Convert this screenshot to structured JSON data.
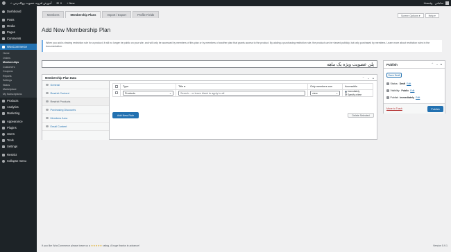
{
  "adminbar": {
    "site_name": "آموزش افزونه عضویت ووکامرس",
    "comments_count": "0",
    "new_label": "+ New",
    "howdy": "Howdy,",
    "username": "سامانی"
  },
  "sidebar": {
    "items": [
      {
        "label": "Dashboard",
        "icon": "dashboard-icon"
      },
      {
        "label": "Posts",
        "icon": "pin-icon"
      },
      {
        "label": "Media",
        "icon": "media-icon"
      },
      {
        "label": "Pages",
        "icon": "page-icon"
      },
      {
        "label": "Comments",
        "icon": "comment-icon"
      },
      {
        "label": "WooCommerce",
        "icon": "woo-icon",
        "active": true
      },
      {
        "label": "Products",
        "icon": "box-icon"
      },
      {
        "label": "Analytics",
        "icon": "chart-icon"
      },
      {
        "label": "Marketing",
        "icon": "megaphone-icon"
      },
      {
        "label": "Appearance",
        "icon": "brush-icon"
      },
      {
        "label": "Plugins",
        "icon": "plug-icon"
      },
      {
        "label": "Users",
        "icon": "user-icon"
      },
      {
        "label": "Tools",
        "icon": "wrench-icon"
      },
      {
        "label": "Settings",
        "icon": "settings-icon"
      },
      {
        "label": "Restrict",
        "icon": "lock-icon"
      },
      {
        "label": "Collapse menu",
        "icon": "collapse-icon"
      }
    ],
    "woo_submenu": [
      "Home",
      "Orders",
      "Memberships",
      "Customers",
      "Coupons",
      "Reports",
      "Settings",
      "Status",
      "Marketplace",
      "My Subscriptions"
    ]
  },
  "tabs": [
    "Members",
    "Membership Plans",
    "Import / Export",
    "Profile Fields"
  ],
  "screen_options": {
    "screen": "Screen Options ▾",
    "help": "Help ▾"
  },
  "page": {
    "title": "Add New Membership Plan",
    "notice": "When you add a viewing restriction rule for a product, it will no longer be public on your site, and will only be accessed by members of this plan or by members of another plan that grants access to the product. By adding a purchasing restriction rule, the product can be viewed publicly, but only purchased by members. Learn more about restriction rules in the documentation.",
    "plan_title": "پلن عضویت ویژه یک ماهه"
  },
  "plan_box": {
    "title": "Membership Plan Data",
    "side_tabs": [
      "General",
      "Restrict Content",
      "Restrict Products",
      "Purchasing Discounts",
      "Members Area",
      "Email Content"
    ],
    "table": {
      "headers": [
        "Type",
        "Title",
        "Only members can",
        "Accessible"
      ],
      "row": {
        "type": "Products",
        "title_placeholder": "Search... or leave blank to apply to all",
        "members_can": "view",
        "radio_immediately": "Immediately",
        "radio_specify": "Specify a time"
      }
    },
    "add_rule": "Add New Rule",
    "delete_selected": "Delete Selected"
  },
  "publish": {
    "title": "Publish",
    "save_draft": "Save Draft",
    "status_label": "Status:",
    "status_value": "Draft",
    "visibility_label": "Visibility:",
    "visibility_value": "Public",
    "publish_label": "Publish",
    "publish_value": "immediately",
    "edit": "Edit",
    "trash": "Move to Trash",
    "publish_btn": "Publish"
  },
  "footer": {
    "text_prefix": "If you like WooCommerce please leave us a",
    "stars": "★★★★★",
    "text_suffix": "rating. A huge thanks in advance!",
    "version": "Version 5.9.1"
  },
  "colors": {
    "accent": "#2271b1",
    "sidebar": "#1d2327",
    "danger": "#b32d2e"
  }
}
